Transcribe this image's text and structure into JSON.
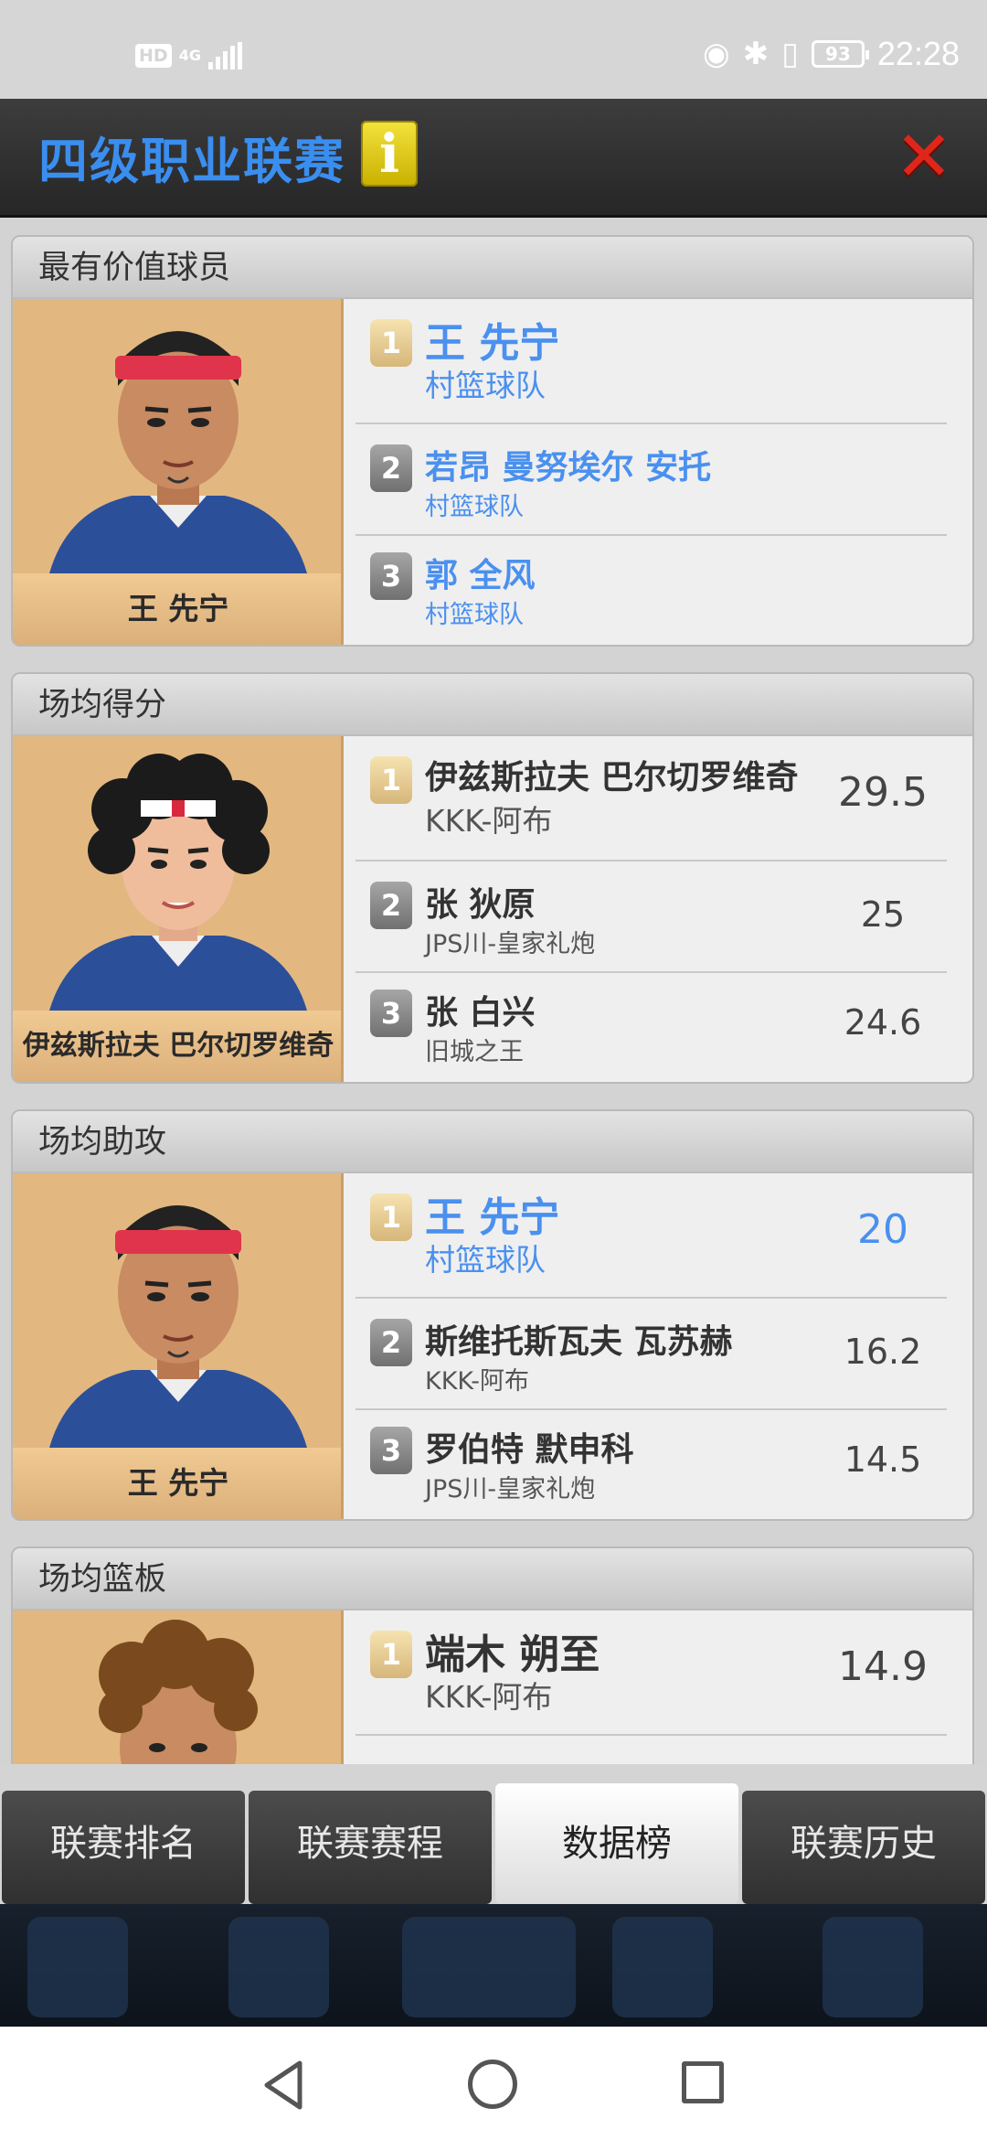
{
  "status_bar": {
    "hd": "HD",
    "network": "4G",
    "battery": "93",
    "time": "22:28"
  },
  "header": {
    "title": "四级职业联赛",
    "info_icon": "i",
    "close_icon": "✕"
  },
  "sections": [
    {
      "title": "最有价值球员",
      "featured": "王 先宁",
      "rows": [
        {
          "rank": "1",
          "name": "王 先宁",
          "team": "村篮球队",
          "value": ""
        },
        {
          "rank": "2",
          "name": "若昂 曼努埃尔 安托",
          "team": "村篮球队",
          "value": ""
        },
        {
          "rank": "3",
          "name": "郭 全风",
          "team": "村篮球队",
          "value": ""
        }
      ]
    },
    {
      "title": "场均得分",
      "featured": "伊兹斯拉夫 巴尔切罗维奇",
      "rows": [
        {
          "rank": "1",
          "name": "伊兹斯拉夫 巴尔切罗维奇",
          "team": "KKK-阿布",
          "value": "29.5"
        },
        {
          "rank": "2",
          "name": "张 狄原",
          "team": "JPS川-皇家礼炮",
          "value": "25"
        },
        {
          "rank": "3",
          "name": "张 白兴",
          "team": "旧城之王",
          "value": "24.6"
        }
      ]
    },
    {
      "title": "场均助攻",
      "featured": "王 先宁",
      "rows": [
        {
          "rank": "1",
          "name": "王 先宁",
          "team": "村篮球队",
          "value": "20"
        },
        {
          "rank": "2",
          "name": "斯维托斯瓦夫 瓦苏赫",
          "team": "KKK-阿布",
          "value": "16.2"
        },
        {
          "rank": "3",
          "name": "罗伯特 默申科",
          "team": "JPS川-皇家礼炮",
          "value": "14.5"
        }
      ]
    },
    {
      "title": "场均篮板",
      "featured": "",
      "rows": [
        {
          "rank": "1",
          "name": "端木 朔至",
          "team": "KKK-阿布",
          "value": "14.9"
        }
      ]
    }
  ],
  "tabs": [
    "联赛排名",
    "联赛赛程",
    "数据榜",
    "联赛历史"
  ],
  "active_tab": "数据榜",
  "colors": {
    "accent_blue": "#4a90ef",
    "portrait_bg": "#e2b880",
    "close_red": "#e0251a",
    "info_yellow": "#e8d21c"
  }
}
